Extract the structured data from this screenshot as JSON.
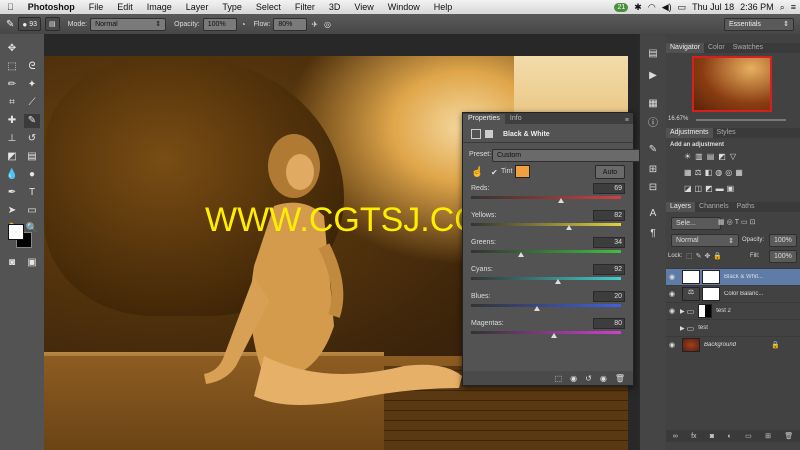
{
  "menubar": {
    "apple": "",
    "app": "Photoshop",
    "items": [
      "File",
      "Edit",
      "Image",
      "Layer",
      "Type",
      "Select",
      "Filter",
      "3D",
      "View",
      "Window",
      "Help"
    ],
    "badge": "21",
    "clock": "Thu Jul 18",
    "time": "2:36 PM"
  },
  "options": {
    "mode_label": "Mode:",
    "mode_value": "Normal",
    "opacity_label": "Opacity:",
    "opacity_value": "100%",
    "flow_label": "Flow:",
    "flow_value": "80%",
    "brush_size": "93",
    "workspace": "Essentials"
  },
  "watermark": "WWW.CGTSJ.COM",
  "properties": {
    "tabs": [
      "Properties",
      "Info"
    ],
    "title": "Black & White",
    "preset_label": "Preset:",
    "preset_value": "Custom",
    "tint_label": "Tint",
    "tint_color": "#f0a040",
    "auto_label": "Auto",
    "sliders": [
      {
        "name": "Reds:",
        "value": "69",
        "pos": 0.6
      },
      {
        "name": "Yellows:",
        "value": "82",
        "pos": 0.65
      },
      {
        "name": "Greens:",
        "value": "34",
        "pos": 0.33
      },
      {
        "name": "Cyans:",
        "value": "92",
        "pos": 0.58
      },
      {
        "name": "Blues:",
        "value": "20",
        "pos": 0.44
      },
      {
        "name": "Magentas:",
        "value": "80",
        "pos": 0.55
      }
    ]
  },
  "navigator": {
    "tabs": [
      "Navigator",
      "Color",
      "Swatches"
    ],
    "zoom": "16.67%"
  },
  "adjustments": {
    "tabs": [
      "Adjustments",
      "Styles"
    ],
    "hint": "Add an adjustment"
  },
  "layers": {
    "tabs": [
      "Layers",
      "Channels",
      "Paths"
    ],
    "kind": "Sele...",
    "blend": "Normal",
    "opacity_label": "Opacity:",
    "opacity": "100%",
    "lock_label": "Lock:",
    "fill_label": "Fill:",
    "fill": "100%",
    "items": [
      {
        "name": "Black & Whit...",
        "selected": true
      },
      {
        "name": "Color Balanc...",
        "selected": false
      },
      {
        "name": "test 2",
        "selected": false
      },
      {
        "name": "test",
        "selected": false
      },
      {
        "name": "Background",
        "selected": false
      }
    ]
  }
}
